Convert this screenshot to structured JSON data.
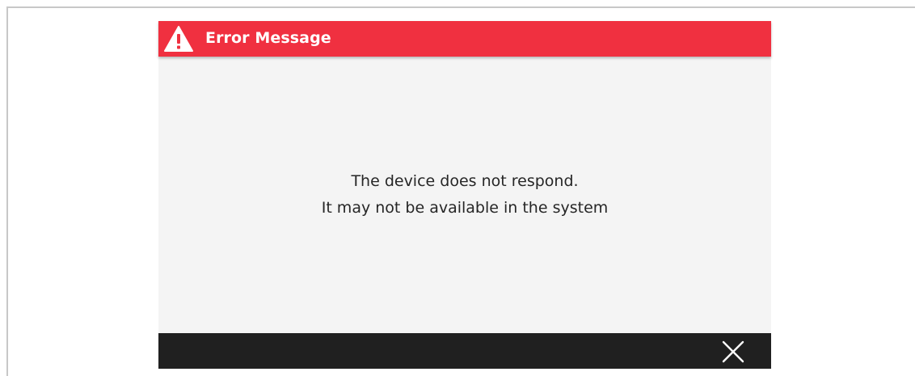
{
  "dialog": {
    "title": "Error Message",
    "header_icon": "warning-icon",
    "message_lines": [
      "The device does not respond.",
      "It may not be available in the system"
    ],
    "close_icon": "close-icon"
  },
  "colors": {
    "header_background": "#f03040",
    "body_background": "#f4f4f4",
    "footer_background": "#202020",
    "title_text": "#ffffff",
    "message_text": "#262626",
    "frame_border": "#c8c8c8"
  }
}
